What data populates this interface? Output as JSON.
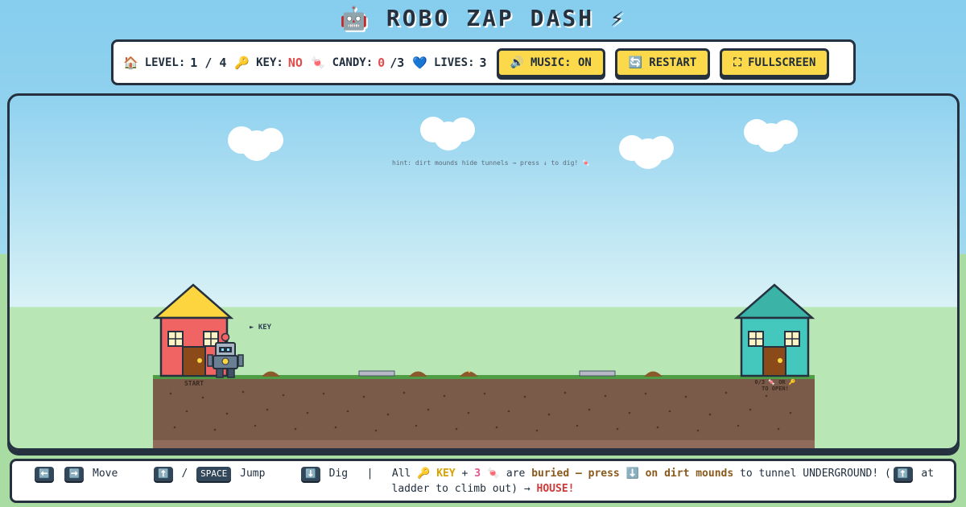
{
  "title": {
    "icon": "🤖",
    "text": "ROBO ZAP DASH",
    "bolt": "⚡"
  },
  "hud": {
    "level": {
      "icon": "🏠",
      "label": "LEVEL:",
      "value": "1 / 4"
    },
    "key": {
      "icon": "🔑",
      "label": "KEY:",
      "value": "NO"
    },
    "candy": {
      "icon": "🍬",
      "label": "CANDY:",
      "value": "0",
      "total": "/3"
    },
    "lives": {
      "icon": "💙",
      "label": "LIVES:",
      "value": "3"
    }
  },
  "buttons": {
    "music": {
      "icon": "🔊",
      "label": "MUSIC: ON"
    },
    "restart": {
      "icon": "🔄",
      "label": "RESTART"
    },
    "fullscreen": {
      "icon": "⛶",
      "label": "FULLSCREEN"
    }
  },
  "game": {
    "hint": "hint: dirt mounds hide tunnels → press ↓ to dig! 🍬",
    "key_pointer": "► KEY",
    "start_label": "START",
    "house_req": "0/3 🍬 OR 🔑",
    "house_req2": "TO OPEN!",
    "colors": {
      "house_start": "#f16464",
      "roof_start": "#fcd53f",
      "house_end": "#44c7bc",
      "roof_end": "#3bb3a6",
      "dirt": "#7a5a48",
      "grass": "#4f9d45"
    }
  },
  "controls": {
    "left_key": "⬅️",
    "right_key": "➡️",
    "move": "Move",
    "up_key": "⬆️",
    "slash": "/",
    "space_key": "SPACE",
    "jump": "Jump",
    "down_key": "⬇️",
    "dig": "Dig",
    "sep": "|",
    "all": "All",
    "key_icon": "🔑",
    "key_word": "KEY",
    "plus": "+",
    "three": "3",
    "candy_icon": "🍬",
    "are": "are",
    "buried": "buried — press",
    "down2": "⬇️",
    "on_mounds": "on dirt mounds",
    "to_tunnel": "to tunnel UNDERGROUND! (",
    "ladder_key": "⬆️",
    "at_ladder": "at ladder to climb out) →",
    "house": "HOUSE!"
  }
}
